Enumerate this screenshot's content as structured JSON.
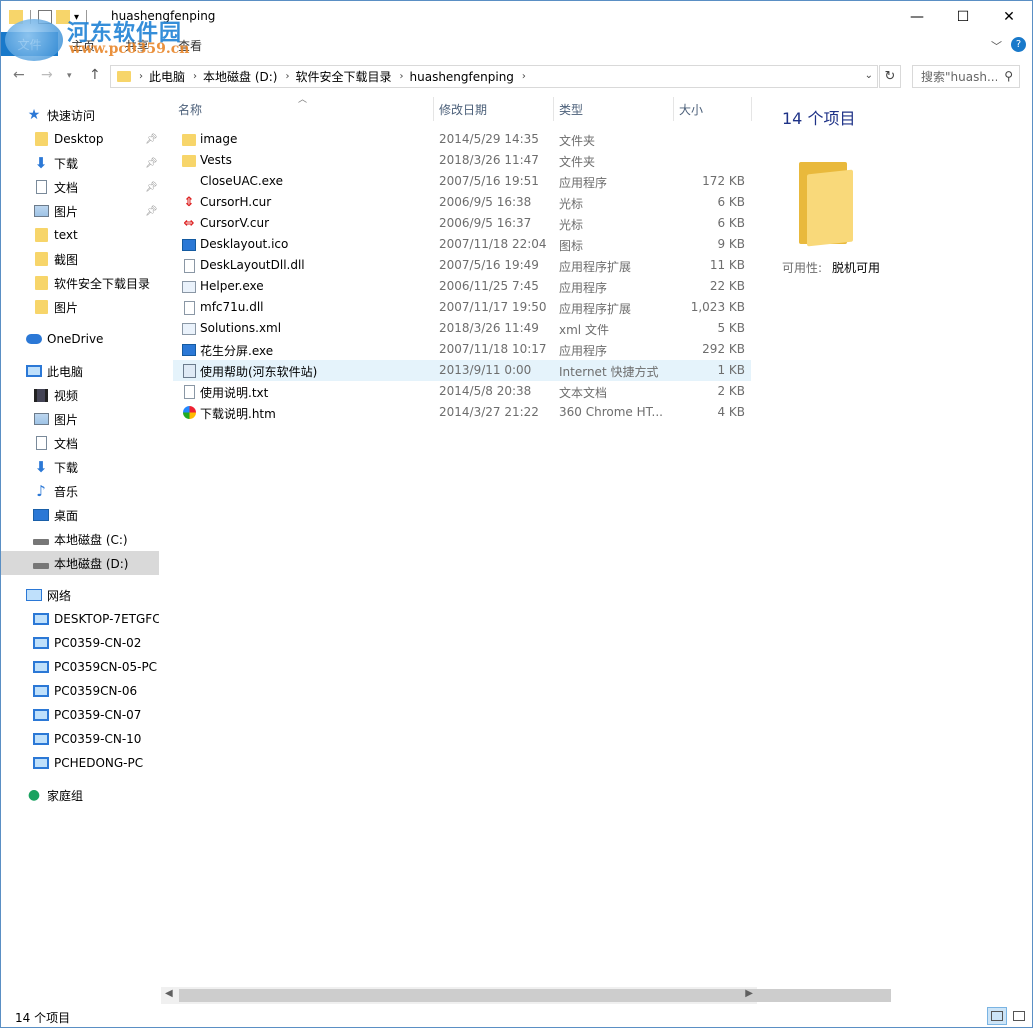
{
  "window": {
    "title": "huashengfenping",
    "controls": {
      "minimize": "—",
      "maximize": "☐",
      "close": "✕"
    }
  },
  "watermark": {
    "name": "河东软件园",
    "url": "www.pc0359.cn"
  },
  "ribbon": {
    "file_tab": "文件",
    "tabs": [
      "主页",
      "共享",
      "查看"
    ],
    "help": "?"
  },
  "address": {
    "breadcrumbs": [
      "此电脑",
      "本地磁盘 (D:)",
      "软件安全下载目录",
      "huashengfenping"
    ],
    "search_placeholder": "搜索\"huash..."
  },
  "navigation": {
    "quick_access": {
      "label": "快速访问",
      "items": [
        {
          "label": "Desktop",
          "icon": "folder-icon",
          "pinned": true
        },
        {
          "label": "下载",
          "icon": "download-icon",
          "pinned": true
        },
        {
          "label": "文档",
          "icon": "document-icon",
          "pinned": true
        },
        {
          "label": "图片",
          "icon": "picture-icon",
          "pinned": true
        },
        {
          "label": "text",
          "icon": "folder-icon",
          "pinned": false
        },
        {
          "label": "截图",
          "icon": "folder-icon",
          "pinned": false
        },
        {
          "label": "软件安全下载目录",
          "icon": "folder-icon",
          "pinned": false
        },
        {
          "label": "图片",
          "icon": "folder-icon",
          "pinned": false
        }
      ]
    },
    "onedrive": {
      "label": "OneDrive"
    },
    "this_pc": {
      "label": "此电脑",
      "items": [
        {
          "label": "视频",
          "icon": "video-icon"
        },
        {
          "label": "图片",
          "icon": "picture-icon"
        },
        {
          "label": "文档",
          "icon": "document-icon"
        },
        {
          "label": "下载",
          "icon": "download-icon"
        },
        {
          "label": "音乐",
          "icon": "music-icon"
        },
        {
          "label": "桌面",
          "icon": "desktop-icon"
        },
        {
          "label": "本地磁盘 (C:)",
          "icon": "drive-icon"
        },
        {
          "label": "本地磁盘 (D:)",
          "icon": "drive-icon",
          "selected": true
        }
      ]
    },
    "network": {
      "label": "网络",
      "items": [
        "DESKTOP-7ETGFC",
        "PC0359-CN-02",
        "PC0359CN-05-PC",
        "PC0359CN-06",
        "PC0359-CN-07",
        "PC0359-CN-10",
        "PCHEDONG-PC"
      ]
    },
    "homegroup": {
      "label": "家庭组"
    }
  },
  "columns": {
    "name": "名称",
    "date": "修改日期",
    "type": "类型",
    "size": "大小"
  },
  "files": [
    {
      "name": "image",
      "date": "2014/5/29 14:35",
      "type": "文件夹",
      "size": "",
      "icon": "folder-icon"
    },
    {
      "name": "Vests",
      "date": "2018/3/26 11:47",
      "type": "文件夹",
      "size": "",
      "icon": "folder-icon"
    },
    {
      "name": "CloseUAC.exe",
      "date": "2007/5/16 19:51",
      "type": "应用程序",
      "size": "172 KB",
      "icon": "blank-exe-icon"
    },
    {
      "name": "CursorH.cur",
      "date": "2006/9/5 16:38",
      "type": "光标",
      "size": "6 KB",
      "icon": "cursor-h-icon"
    },
    {
      "name": "CursorV.cur",
      "date": "2006/9/5 16:37",
      "type": "光标",
      "size": "6 KB",
      "icon": "cursor-v-icon"
    },
    {
      "name": "Desklayout.ico",
      "date": "2007/11/18 22:04",
      "type": "图标",
      "size": "9 KB",
      "icon": "ico-image-icon"
    },
    {
      "name": "DeskLayoutDll.dll",
      "date": "2007/5/16 19:49",
      "type": "应用程序扩展",
      "size": "11 KB",
      "icon": "dll-icon"
    },
    {
      "name": "Helper.exe",
      "date": "2006/11/25 7:45",
      "type": "应用程序",
      "size": "22 KB",
      "icon": "app-icon"
    },
    {
      "name": "mfc71u.dll",
      "date": "2007/11/17 19:50",
      "type": "应用程序扩展",
      "size": "1,023 KB",
      "icon": "dll-icon"
    },
    {
      "name": "Solutions.xml",
      "date": "2018/3/26 11:49",
      "type": "xml 文件",
      "size": "5 KB",
      "icon": "xml-icon"
    },
    {
      "name": "花生分屏.exe",
      "date": "2007/11/18 10:17",
      "type": "应用程序",
      "size": "292 KB",
      "icon": "app-icon"
    },
    {
      "name": "使用帮助(河东软件站)",
      "date": "2013/9/11 0:00",
      "type": "Internet 快捷方式",
      "size": "1 KB",
      "icon": "url-shortcut-icon",
      "hover": true
    },
    {
      "name": "使用说明.txt",
      "date": "2014/5/8 20:38",
      "type": "文本文档",
      "size": "2 KB",
      "icon": "text-file-icon"
    },
    {
      "name": "下载说明.htm",
      "date": "2014/3/27 21:22",
      "type": "360 Chrome HT...",
      "size": "4 KB",
      "icon": "htm-icon"
    }
  ],
  "details": {
    "count": "14 个项目",
    "availability_label": "可用性:",
    "availability_value": "脱机可用"
  },
  "status": {
    "count": "14 个项目"
  }
}
